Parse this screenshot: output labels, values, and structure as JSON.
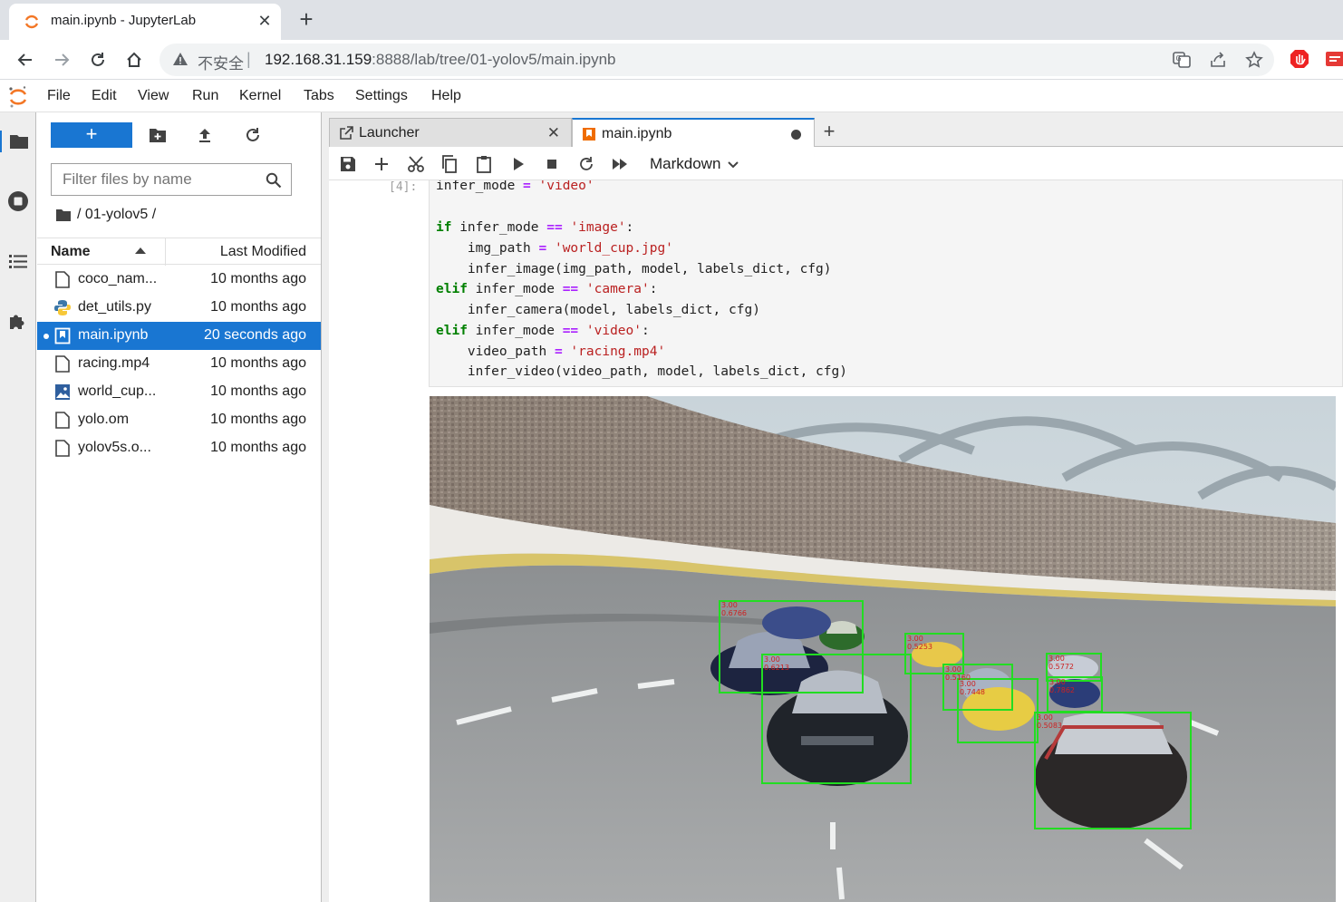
{
  "browser": {
    "tab_title": "main.ipynb - JupyterLab",
    "insecure_label": "不安全",
    "url_host": "192.168.31.159",
    "url_rest": ":8888/lab/tree/01-yolov5/main.ipynb"
  },
  "menu": [
    "File",
    "Edit",
    "View",
    "Run",
    "Kernel",
    "Tabs",
    "Settings",
    "Help"
  ],
  "filebrowser": {
    "new_button": "+",
    "filter_placeholder": "Filter files by name",
    "breadcrumb": "/ 01-yolov5 /",
    "col_name": "Name",
    "col_modified": "Last Modified",
    "files": [
      {
        "name": "coco_nam...",
        "modified": "10 months ago",
        "icon": "file-icon"
      },
      {
        "name": "det_utils.py",
        "modified": "10 months ago",
        "icon": "python-icon"
      },
      {
        "name": "main.ipynb",
        "modified": "20 seconds ago",
        "icon": "notebook-icon",
        "selected": true
      },
      {
        "name": "racing.mp4",
        "modified": "10 months ago",
        "icon": "file-icon"
      },
      {
        "name": "world_cup...",
        "modified": "10 months ago",
        "icon": "image-icon"
      },
      {
        "name": "yolo.om",
        "modified": "10 months ago",
        "icon": "file-icon"
      },
      {
        "name": "yolov5s.o...",
        "modified": "10 months ago",
        "icon": "file-icon"
      }
    ]
  },
  "docktabs": [
    {
      "label": "Launcher"
    },
    {
      "label": "main.ipynb"
    }
  ],
  "notebook": {
    "cell_type": "Markdown",
    "prompt": "[4]:",
    "code": [
      "infer_mode = 'video'",
      "",
      "if infer_mode == 'image':",
      "    img_path = 'world_cup.jpg'",
      "    infer_image(img_path, model, labels_dict, cfg)",
      "elif infer_mode == 'camera':",
      "    infer_camera(model, labels_dict, cfg)",
      "elif infer_mode == 'video':",
      "    video_path = 'racing.mp4'",
      "    infer_video(video_path, model, labels_dict, cfg)"
    ],
    "detections": [
      {
        "label": "3.00",
        "score": "0.6766"
      },
      {
        "label": "3.00",
        "score": "0.5253"
      },
      {
        "label": "3.00",
        "score": "0.5160"
      },
      {
        "label": "3.00",
        "score": "0.7862"
      },
      {
        "label": "3.00",
        "score": "0.5083"
      },
      {
        "label": "3.00",
        "score": "0.5772"
      },
      {
        "label": "3.00",
        "score": "0.7448"
      },
      {
        "label": "3.00",
        "score": "0.6213"
      }
    ]
  },
  "colors": {
    "accent": "#1976d2",
    "detection_box": "#22dd22",
    "detection_text": "#cc2222"
  }
}
